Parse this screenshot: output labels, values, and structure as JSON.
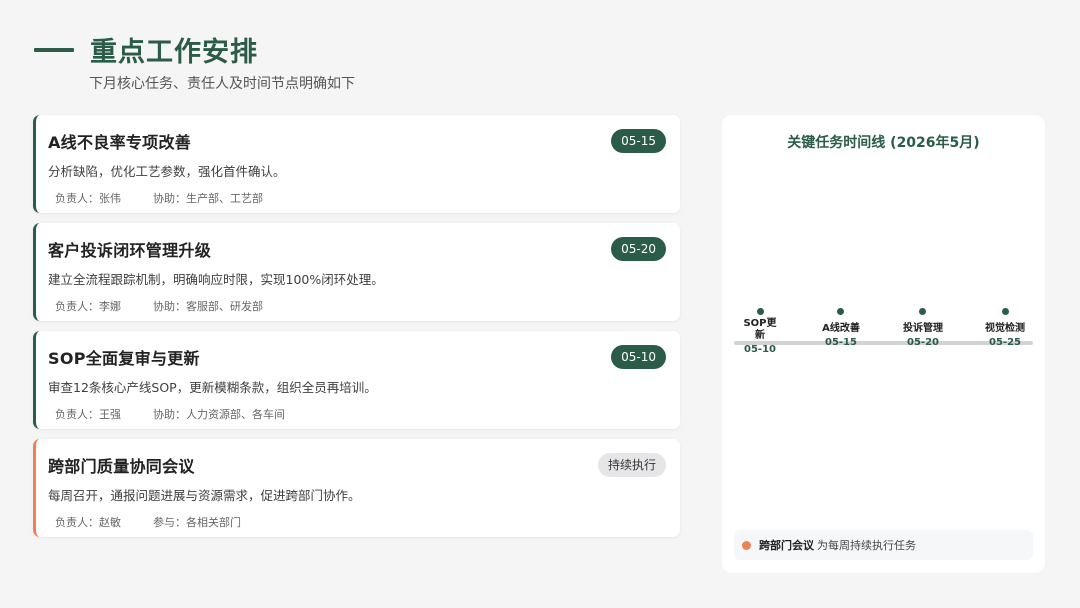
{
  "header": {
    "title": "重点工作安排",
    "subtitle": "下月核心任务、责任人及时间节点明确如下"
  },
  "tasks": [
    {
      "title": "A线不良率专项改善",
      "desc": "分析缺陷，优化工艺参数，强化首件确认。",
      "owner": "负责人：张伟",
      "assist": "协助：生产部、工艺部",
      "badge": "05-15"
    },
    {
      "title": "客户投诉闭环管理升级",
      "desc": "建立全流程跟踪机制，明确响应时限，实现100%闭环处理。",
      "owner": "负责人：李娜",
      "assist": "协助：客服部、研发部",
      "badge": "05-20"
    },
    {
      "title": "SOP全面复审与更新",
      "desc": "审查12条核心产线SOP，更新模糊条款，组织全员再培训。",
      "owner": "负责人：王强",
      "assist": "协助：人力资源部、各车间",
      "badge": "05-10"
    },
    {
      "title": "跨部门质量协同会议",
      "desc": "每周召开，通报问题进展与资源需求，促进跨部门协作。",
      "owner": "负责人：赵敏",
      "assist": "参与：各相关部门",
      "badge": "持续执行"
    }
  ],
  "timeline": {
    "title": "关键任务时间线 (2026年5月)",
    "items": [
      {
        "label": "SOP更新",
        "date": "05-10"
      },
      {
        "label": "A线改善",
        "date": "05-15"
      },
      {
        "label": "投诉管理",
        "date": "05-20"
      },
      {
        "label": "视觉检测",
        "date": "05-25"
      }
    ],
    "note_strong": "跨部门会议",
    "note_text": "为每周持续执行任务"
  },
  "colors": {
    "primary": "#2a5c47",
    "accent": "#ec8355",
    "background": "#f5f5f6"
  }
}
